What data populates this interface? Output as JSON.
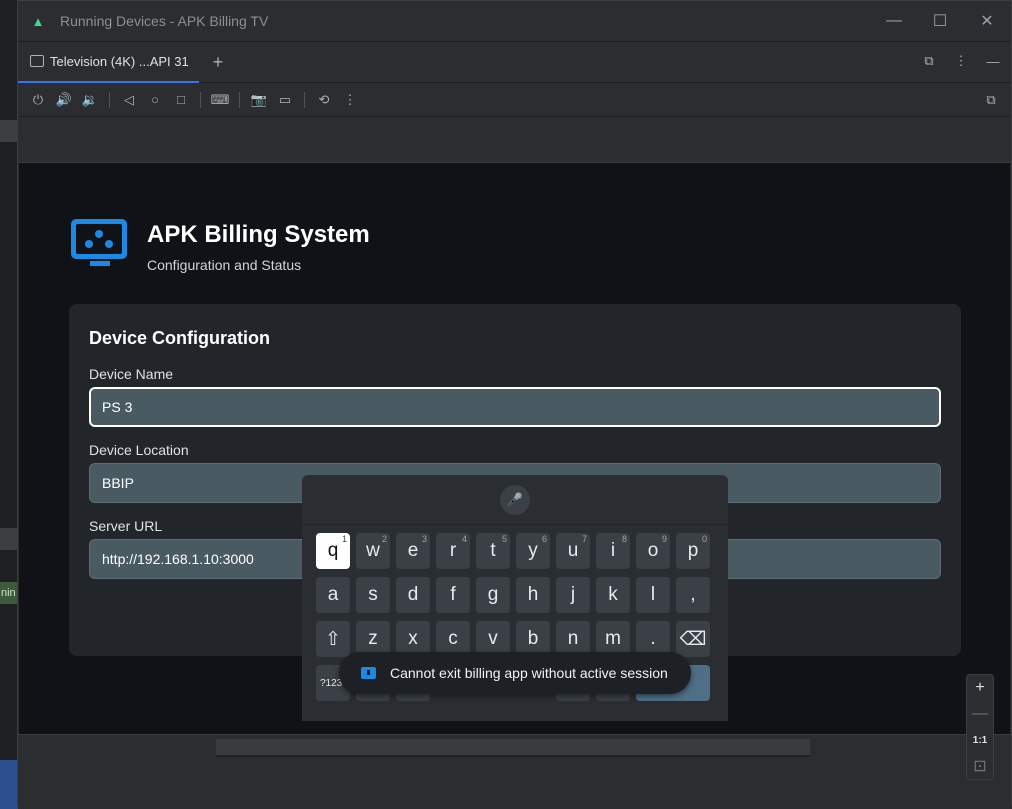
{
  "window": {
    "title": "Running Devices - APK Billing TV",
    "controls": {
      "minimize": "—",
      "maximize": "☐",
      "close": "✕"
    }
  },
  "ide_side": {
    "fragment": "nin"
  },
  "tabs": [
    {
      "label": "Television (4K) ...API 31",
      "active": true
    }
  ],
  "tab_add": "+",
  "tabbar_icons": [
    "window-mode-icon",
    "more-vert-icon",
    "hide-icon"
  ],
  "toolbar_icons": [
    "power-icon",
    "volume-up-icon",
    "volume-down-icon",
    "back-icon",
    "home-icon",
    "overview-icon",
    "keyboard-input-icon",
    "screenshot-icon",
    "screen-record-icon",
    "reset-orientation-icon",
    "more-vert-icon",
    "device-mirror-icon"
  ],
  "app": {
    "title": "APK Billing System",
    "subtitle": "Configuration and Status",
    "accent": "#1e88e5"
  },
  "config": {
    "title": "Device Configuration",
    "fields": [
      {
        "label": "Device Name",
        "value": "PS 3",
        "focused": true
      },
      {
        "label": "Device Location",
        "value": "BBIP",
        "focused": false
      },
      {
        "label": "Server URL",
        "value": "http://192.168.1.10:3000",
        "focused": false
      }
    ]
  },
  "keyboard": {
    "mic": "🎤",
    "row1": [
      {
        "key": "q",
        "num": "1"
      },
      {
        "key": "w",
        "num": "2"
      },
      {
        "key": "e",
        "num": "3"
      },
      {
        "key": "r",
        "num": "4"
      },
      {
        "key": "t",
        "num": "5"
      },
      {
        "key": "y",
        "num": "6"
      },
      {
        "key": "u",
        "num": "7"
      },
      {
        "key": "i",
        "num": "8"
      },
      {
        "key": "o",
        "num": "9"
      },
      {
        "key": "p",
        "num": "0"
      }
    ],
    "row2": [
      "a",
      "s",
      "d",
      "f",
      "g",
      "h",
      "j",
      "k",
      "l",
      ","
    ],
    "row3": [
      "⇧",
      "z",
      "x",
      "c",
      "v",
      "b",
      "n",
      "m",
      ".",
      "⌫"
    ],
    "symbols_key": "?123",
    "selected": "q"
  },
  "toast": {
    "message": "Cannot exit billing app without active session"
  },
  "zoom": {
    "in": "+",
    "out": "—",
    "actual": "1:1",
    "fit": "⊡"
  }
}
